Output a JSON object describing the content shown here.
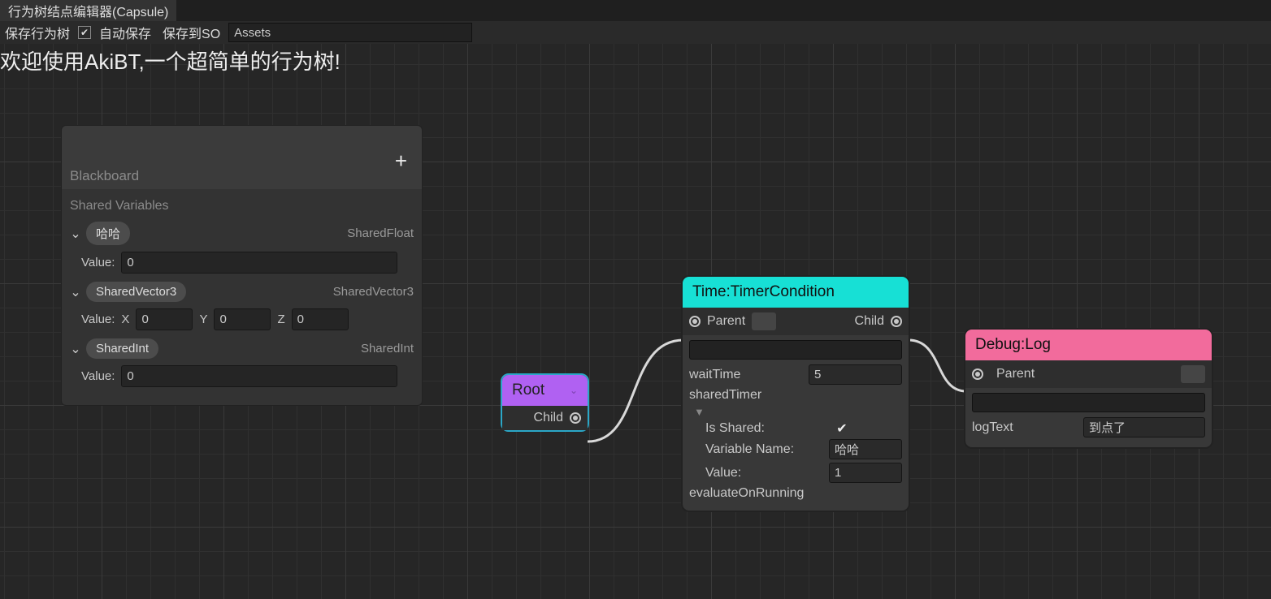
{
  "tab_title": "行为树结点编辑器(Capsule)",
  "toolbar": {
    "save_tree": "保存行为树",
    "auto_save": "自动保存",
    "auto_save_checked": true,
    "save_to_so": "保存到SO",
    "path": "Assets"
  },
  "welcome": "欢迎使用AkiBT,一个超简单的行为树!",
  "blackboard": {
    "title": "Blackboard",
    "section": "Shared Variables",
    "vars": [
      {
        "name": "哈哈",
        "type": "SharedFloat",
        "kind": "float",
        "value": "0"
      },
      {
        "name": "SharedVector3",
        "type": "SharedVector3",
        "kind": "vec3",
        "x": "0",
        "y": "0",
        "z": "0"
      },
      {
        "name": "SharedInt",
        "type": "SharedInt",
        "kind": "int",
        "value": "0"
      }
    ],
    "value_label": "Value:",
    "x_label": "X",
    "y_label": "Y",
    "z_label": "Z"
  },
  "root_node": {
    "title": "Root",
    "child": "Child"
  },
  "timer_node": {
    "title": "Time:TimerCondition",
    "parent": "Parent",
    "child": "Child",
    "fields": {
      "waitTime_label": "waitTime",
      "waitTime": "5",
      "sharedTimer_label": "sharedTimer",
      "isShared_label": "Is Shared:",
      "isShared": true,
      "varName_label": "Variable Name:",
      "varName": "哈哈",
      "value_label": "Value:",
      "value": "1",
      "eval_label": "evaluateOnRunning"
    }
  },
  "debug_node": {
    "title": "Debug:Log",
    "parent": "Parent",
    "fields": {
      "logText_label": "logText",
      "logText": "到点了"
    }
  }
}
